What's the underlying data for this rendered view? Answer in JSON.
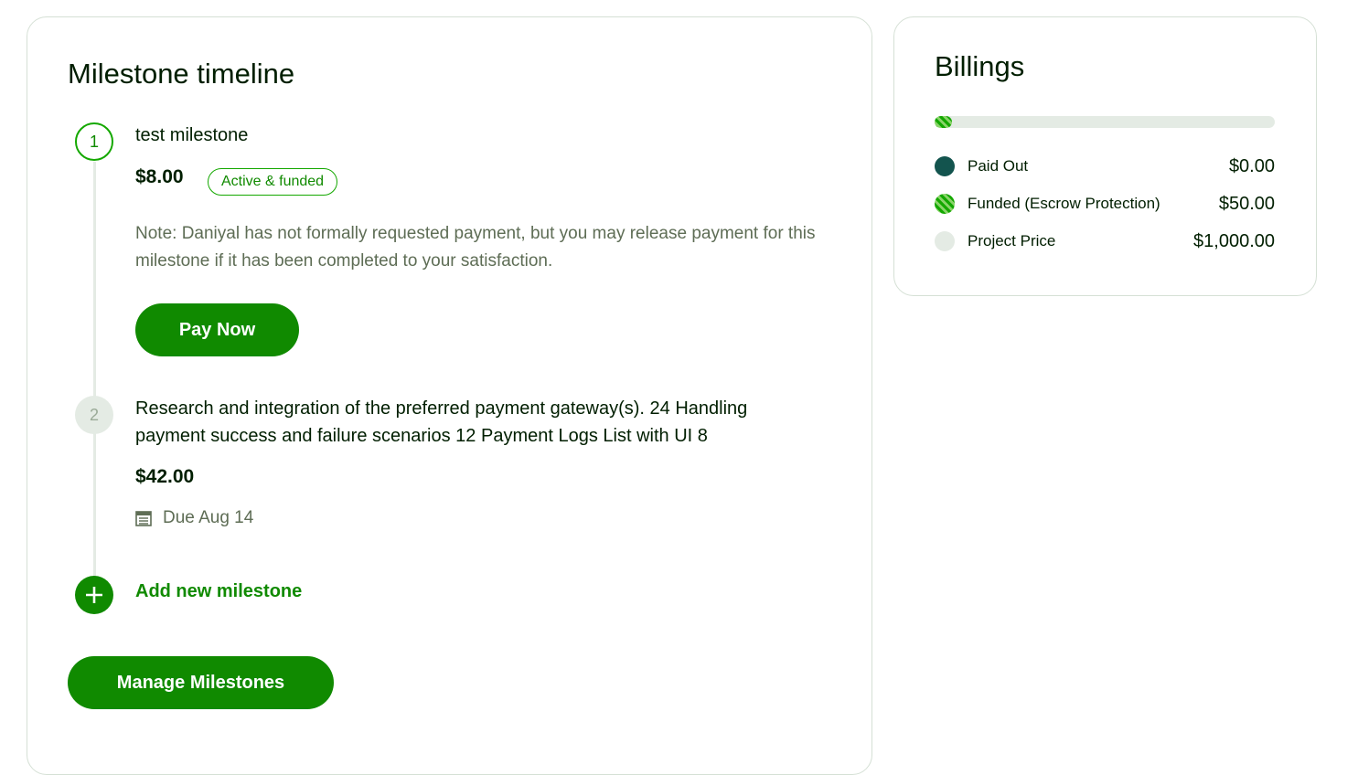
{
  "timeline": {
    "title": "Milestone timeline",
    "milestones": [
      {
        "number": "1",
        "title": "test milestone",
        "amount": "$8.00",
        "status": "Active & funded",
        "note": "Note: Daniyal has not formally requested payment, but you may release payment for this milestone if it has been completed to your satisfaction.",
        "action_label": "Pay Now"
      },
      {
        "number": "2",
        "title": "Research and integration of the preferred payment gateway(s). 24 Handling payment success and failure scenarios 12 Payment Logs List with UI 8",
        "amount": "$42.00",
        "due": "Due Aug 14",
        "due_icon": "calendar-icon"
      }
    ],
    "add_label": "Add new milestone",
    "add_icon": "plus-icon",
    "manage_label": "Manage Milestones"
  },
  "billings": {
    "title": "Billings",
    "progress_fraction": 0.05,
    "rows": [
      {
        "label": "Paid Out",
        "value": "$0.00",
        "color": "#13544e"
      },
      {
        "label": "Funded (Escrow Protection)",
        "value": "$50.00",
        "color": "#14a800"
      },
      {
        "label": "Project Price",
        "value": "$1,000.00",
        "color": "#e4ebe4"
      }
    ]
  },
  "colors": {
    "accent": "#108a00",
    "accent_light": "#14a800",
    "text": "#001e00",
    "muted": "#5e6d55"
  }
}
